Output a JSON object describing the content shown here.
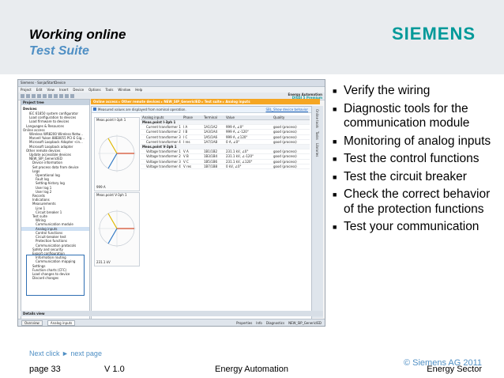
{
  "header": {
    "title": "Working online",
    "subtitle": "Test Suite",
    "logo": "SIEMENS",
    "colors": {
      "band": "#e9ecef",
      "subtitle": "#4f8fc4",
      "logo": "#009999",
      "breadcrumb": "#f5a623"
    }
  },
  "screenshot": {
    "window_title": "Siemens - Sonja/StartDevice",
    "menu": [
      "Project",
      "Edit",
      "View",
      "Insert",
      "Device",
      "Options",
      "Tools",
      "Window",
      "Help"
    ],
    "brand_line1": "Energy Automation",
    "brand_line2": "DIGSI 5 Premium",
    "breadcrumb": "Online access ▸ Other remote devices ▸ NEW_SIP_GenericIED ▸ Test suite ▸ Analog inputs",
    "project_tree_header": "Project tree",
    "devices_tab": "Devices",
    "tree": [
      "IEC 61850 system configurator",
      "Load configuration to devices",
      "Load firmware to devices",
      "Languages & Resources",
      "Online access",
      "Wireless WR8200 Wireless Netw...",
      "Marvell Yukon 88E8055 PCI-E Gig...",
      "Microsoft Loopback Adapter <in...",
      "Microsoft Loopback adapter",
      "Other remote devices",
      "Update accessible devices",
      "NEW_SIP_GenericIED",
      "Device information",
      "Set process data from device",
      "Logs",
      "Operational log",
      "Fault log",
      "Setting-history log",
      "User log 1",
      "User log 2",
      "Records",
      "Indications",
      "Measurements",
      "Line 1",
      "Circuit breaker 1",
      "Test suite",
      "Wiring",
      "Communication module",
      "Analog inputs",
      "Control functions",
      "Circuit-breaker test",
      "Protection functions",
      "Communication protocols",
      "Safety and security",
      "Export configuration",
      "Information routing",
      "Communication mapping",
      "Settings",
      "Function charts (CFC)",
      "Load changes to device",
      "Discard changes"
    ],
    "warning": "Measured values are displayed from nominal operation.",
    "warning_link": "SBL_Show device behavior",
    "table_headers": [
      "Analog inputs",
      "Phase",
      "Terminal",
      "Value",
      "Quality"
    ],
    "rows": [
      {
        "name": "Meas.point I-3ph 1",
        "phase": "",
        "terminal": "",
        "value": "",
        "quality": "",
        "group": true
      },
      {
        "name": "Current transformer 1",
        "phase": "I A",
        "terminal": "1A1/1A2",
        "value": "999 A, ∠0°",
        "quality": "good (process)"
      },
      {
        "name": "Current transformer 2",
        "phase": "I B",
        "terminal": "1A3/1A4",
        "value": "999 A, ∠-120°",
        "quality": "good (process)"
      },
      {
        "name": "Current transformer 3",
        "phase": "I C",
        "terminal": "1A5/1A6",
        "value": "999 A, ∠120°",
        "quality": "good (process)"
      },
      {
        "name": "Current transformer 4",
        "phase": "I res",
        "terminal": "1A7/1A8",
        "value": "0 A, ∠0°",
        "quality": "good (process)"
      },
      {
        "name": "Meas.point V-3ph 1",
        "phase": "",
        "terminal": "",
        "value": "",
        "quality": "",
        "group": true
      },
      {
        "name": "Voltage transformer 1",
        "phase": "V A",
        "terminal": "1B1/1B2",
        "value": "231.1 kV, ∠0°",
        "quality": "good (process)"
      },
      {
        "name": "Voltage transformer 2",
        "phase": "V B",
        "terminal": "1B3/1B4",
        "value": "231.1 kV, ∠-120°",
        "quality": "good (process)"
      },
      {
        "name": "Voltage transformer 3",
        "phase": "V C",
        "terminal": "1B5/1B6",
        "value": "231.1 kV, ∠120°",
        "quality": "good (process)"
      },
      {
        "name": "Voltage transformer 4",
        "phase": "V res",
        "terminal": "1B7/1B8",
        "value": "0 kV, ∠0°",
        "quality": "good (process)"
      }
    ],
    "phasor1_label": "Meas.point I-3ph 1",
    "phasor1_value": "999 A",
    "phasor2_label": "Meas.point V-3ph 1",
    "phasor2_value": "231.1 kV",
    "sidebar_tabs": [
      "Online tools",
      "Tasks",
      "Libraries"
    ],
    "details_view": "Details view",
    "status_tabs": [
      "Overview",
      "Analog inputs"
    ],
    "status_right": [
      "Properties",
      "Info",
      "Diagnostics"
    ],
    "status_device": "NEW_SIP_GenericIED"
  },
  "bullets": [
    "Verify the wiring",
    "Diagnostic tools for the communication module",
    "Monitoring of analog inputs",
    "Test the control functions",
    "Test the circuit breaker",
    "Check the correct behavior of the protection functions",
    "Test your communication"
  ],
  "footer": {
    "next_click": "Next click ► next page",
    "copyright": "© Siemens AG 2011",
    "page": "page 33",
    "version": "V 1.0",
    "center": "Energy Automation",
    "right": "Energy Sector"
  }
}
